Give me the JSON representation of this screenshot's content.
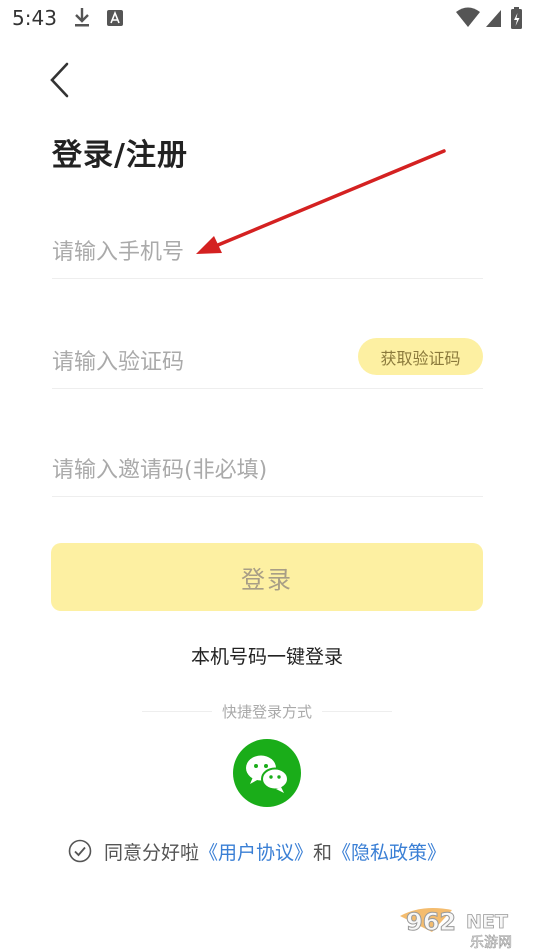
{
  "status_bar": {
    "time": "5:43"
  },
  "page": {
    "title": "登录/注册"
  },
  "form": {
    "phone_placeholder": "请输入手机号",
    "code_placeholder": "请输入验证码",
    "get_code_label": "获取验证码",
    "invite_placeholder": "请输入邀请码(非必填)",
    "login_label": "登录"
  },
  "one_key_login": "本机号码一键登录",
  "quick_login": {
    "label": "快捷登录方式",
    "icon": "wechat-icon"
  },
  "agreement": {
    "prefix": "同意分好啦",
    "user_agreement": "《用户协议》",
    "and": "和",
    "privacy_policy": "《隐私政策》"
  },
  "watermark": {
    "brand": "962",
    "suffix": "NET",
    "subtitle": "乐游网"
  },
  "colors": {
    "accent_yellow": "#fdf0a2",
    "link_blue": "#3a7fd5",
    "wechat_green": "#1aad19",
    "annotation_red": "#d42121"
  }
}
